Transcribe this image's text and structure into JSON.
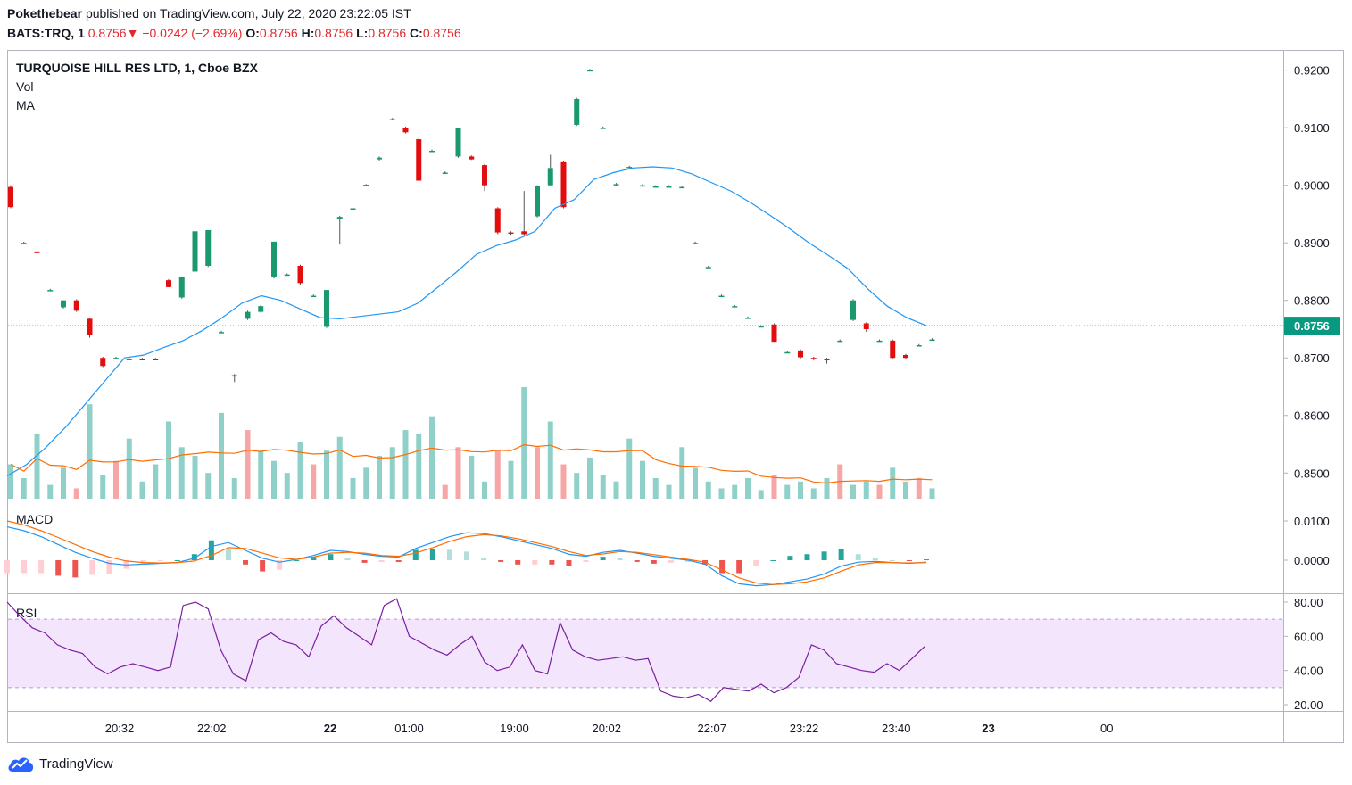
{
  "header": {
    "author": "Pokethebear",
    "published": "published on TradingView.com, July 22, 2020 23:22:05 IST",
    "symbol": "BATS:TRQ, 1",
    "last": "0.8756",
    "change_arrow": "▼",
    "change": "−0.0242 (−2.69%)",
    "o_label": "O:",
    "o": "0.8756",
    "h_label": "H:",
    "h": "0.8756",
    "l_label": "L:",
    "l": "0.8756",
    "c_label": "C:",
    "c": "0.8756"
  },
  "legend": {
    "instrument": "TURQUOISE HILL RES LTD, 1, Cboe BZX",
    "vol": "Vol",
    "ma": "MA",
    "macd": "MACD",
    "rsi": "RSI"
  },
  "brand": "TradingView",
  "colors": {
    "up": "#26a69a",
    "down": "#ef5350",
    "candle_up": "#1a9a6c",
    "candle_down": "#e40d0d",
    "ma": "#2196f3",
    "vol_ma": "#ff6d00",
    "macd": "#2196f3",
    "signal": "#ff6d00",
    "rsi": "#7b1fa2",
    "rsi_band": "#f3e5fb",
    "price_line": "#089981"
  },
  "chart_data": {
    "type": "candlestick",
    "title": "TURQUOISE HILL RES LTD, 1, Cboe BZX",
    "last_price": 0.8756,
    "price_axis": {
      "ticks": [
        "0.9200",
        "0.9100",
        "0.9000",
        "0.8900",
        "0.8800",
        "0.8756",
        "0.8700",
        "0.8600",
        "0.8500"
      ],
      "ylim": [
        0.8457,
        0.9232
      ]
    },
    "macd_axis": {
      "ticks": [
        "0.0100",
        "0.0000"
      ]
    },
    "rsi_axis": {
      "ticks": [
        "80.00",
        "60.00",
        "40.00",
        "20.00"
      ],
      "bands": [
        30,
        70
      ]
    },
    "x_ticks": [
      {
        "label": "20:32",
        "bold": false,
        "i": 8
      },
      {
        "label": "22:02",
        "bold": false,
        "i": 15
      },
      {
        "label": "22",
        "bold": true,
        "i": 24
      },
      {
        "label": "01:00",
        "bold": false,
        "i": 30
      },
      {
        "label": "19:00",
        "bold": false,
        "i": 38
      },
      {
        "label": "20:02",
        "bold": false,
        "i": 45
      },
      {
        "label": "22:07",
        "bold": false,
        "i": 53
      },
      {
        "label": "23:22",
        "bold": false,
        "i": 60
      },
      {
        "label": "23:40",
        "bold": false,
        "i": 67
      },
      {
        "label": "23",
        "bold": true,
        "i": 74
      },
      {
        "label": "00",
        "bold": false,
        "i": 83
      }
    ],
    "candles": [
      {
        "o": 0.8997,
        "h": 0.9,
        "l": 0.896,
        "c": 0.8962
      },
      {
        "o": 0.89,
        "h": 0.8902,
        "l": 0.8898,
        "c": 0.89
      },
      {
        "o": 0.8885,
        "h": 0.8888,
        "l": 0.888,
        "c": 0.8882
      },
      {
        "o": 0.8818,
        "h": 0.882,
        "l": 0.8816,
        "c": 0.8818
      },
      {
        "o": 0.8788,
        "h": 0.88,
        "l": 0.8786,
        "c": 0.88
      },
      {
        "o": 0.88,
        "h": 0.8802,
        "l": 0.878,
        "c": 0.8782
      },
      {
        "o": 0.8768,
        "h": 0.877,
        "l": 0.8735,
        "c": 0.874
      },
      {
        "o": 0.87,
        "h": 0.8702,
        "l": 0.8684,
        "c": 0.8686
      },
      {
        "o": 0.87,
        "h": 0.8702,
        "l": 0.8698,
        "c": 0.87
      },
      {
        "o": 0.8698,
        "h": 0.87,
        "l": 0.8696,
        "c": 0.8698
      },
      {
        "o": 0.8698,
        "h": 0.87,
        "l": 0.8696,
        "c": 0.8697
      },
      {
        "o": 0.8698,
        "h": 0.87,
        "l": 0.8696,
        "c": 0.8697
      },
      {
        "o": 0.8835,
        "h": 0.8837,
        "l": 0.8823,
        "c": 0.8823
      },
      {
        "o": 0.8805,
        "h": 0.884,
        "l": 0.8803,
        "c": 0.884
      },
      {
        "o": 0.885,
        "h": 0.892,
        "l": 0.8848,
        "c": 0.892
      },
      {
        "o": 0.886,
        "h": 0.8922,
        "l": 0.8858,
        "c": 0.8922
      },
      {
        "o": 0.8745,
        "h": 0.8747,
        "l": 0.8743,
        "c": 0.8745
      },
      {
        "o": 0.867,
        "h": 0.8672,
        "l": 0.8658,
        "c": 0.8668
      },
      {
        "o": 0.8768,
        "h": 0.8782,
        "l": 0.8766,
        "c": 0.878
      },
      {
        "o": 0.878,
        "h": 0.8792,
        "l": 0.8778,
        "c": 0.879
      },
      {
        "o": 0.884,
        "h": 0.8902,
        "l": 0.8838,
        "c": 0.8902
      },
      {
        "o": 0.8845,
        "h": 0.8847,
        "l": 0.8843,
        "c": 0.8845
      },
      {
        "o": 0.886,
        "h": 0.8862,
        "l": 0.8826,
        "c": 0.883
      },
      {
        "o": 0.8808,
        "h": 0.881,
        "l": 0.8806,
        "c": 0.8808
      },
      {
        "o": 0.8754,
        "h": 0.8818,
        "l": 0.8752,
        "c": 0.8818
      },
      {
        "o": 0.8942,
        "h": 0.8947,
        "l": 0.8897,
        "c": 0.8945
      },
      {
        "o": 0.896,
        "h": 0.8962,
        "l": 0.8958,
        "c": 0.896
      },
      {
        "o": 0.9,
        "h": 0.9002,
        "l": 0.8998,
        "c": 0.9001
      },
      {
        "o": 0.9045,
        "h": 0.905,
        "l": 0.9043,
        "c": 0.9048
      },
      {
        "o": 0.9115,
        "h": 0.9117,
        "l": 0.9113,
        "c": 0.9115
      },
      {
        "o": 0.91,
        "h": 0.9102,
        "l": 0.909,
        "c": 0.9092
      },
      {
        "o": 0.908,
        "h": 0.9082,
        "l": 0.9008,
        "c": 0.9008
      },
      {
        "o": 0.906,
        "h": 0.9062,
        "l": 0.9058,
        "c": 0.906
      },
      {
        "o": 0.9022,
        "h": 0.9024,
        "l": 0.902,
        "c": 0.9022
      },
      {
        "o": 0.905,
        "h": 0.91,
        "l": 0.9048,
        "c": 0.91
      },
      {
        "o": 0.905,
        "h": 0.9052,
        "l": 0.9044,
        "c": 0.9045
      },
      {
        "o": 0.9035,
        "h": 0.9037,
        "l": 0.899,
        "c": 0.9
      },
      {
        "o": 0.896,
        "h": 0.8962,
        "l": 0.8915,
        "c": 0.8918
      },
      {
        "o": 0.8918,
        "h": 0.892,
        "l": 0.8914,
        "c": 0.8916
      },
      {
        "o": 0.892,
        "h": 0.899,
        "l": 0.8912,
        "c": 0.8915
      },
      {
        "o": 0.8946,
        "h": 0.9,
        "l": 0.8944,
        "c": 0.8998
      },
      {
        "o": 0.9,
        "h": 0.9053,
        "l": 0.8998,
        "c": 0.903
      },
      {
        "o": 0.904,
        "h": 0.9042,
        "l": 0.896,
        "c": 0.8962
      },
      {
        "o": 0.9105,
        "h": 0.9152,
        "l": 0.9103,
        "c": 0.915
      },
      {
        "o": 0.92,
        "h": 0.9202,
        "l": 0.9198,
        "c": 0.92
      },
      {
        "o": 0.91,
        "h": 0.9102,
        "l": 0.9098,
        "c": 0.91
      },
      {
        "o": 0.9002,
        "h": 0.9004,
        "l": 0.9,
        "c": 0.9002
      },
      {
        "o": 0.9032,
        "h": 0.9034,
        "l": 0.903,
        "c": 0.9032
      },
      {
        "o": 0.9,
        "h": 0.9002,
        "l": 0.8998,
        "c": 0.9
      },
      {
        "o": 0.8998,
        "h": 0.9,
        "l": 0.8996,
        "c": 0.8998
      },
      {
        "o": 0.8998,
        "h": 0.9,
        "l": 0.8996,
        "c": 0.8998
      },
      {
        "o": 0.8997,
        "h": 0.8999,
        "l": 0.8995,
        "c": 0.8997
      },
      {
        "o": 0.89,
        "h": 0.8902,
        "l": 0.8898,
        "c": 0.89
      },
      {
        "o": 0.8858,
        "h": 0.886,
        "l": 0.8856,
        "c": 0.8858
      },
      {
        "o": 0.8808,
        "h": 0.881,
        "l": 0.8806,
        "c": 0.8808
      },
      {
        "o": 0.879,
        "h": 0.8792,
        "l": 0.8788,
        "c": 0.879
      },
      {
        "o": 0.877,
        "h": 0.8772,
        "l": 0.8768,
        "c": 0.877
      },
      {
        "o": 0.8755,
        "h": 0.8757,
        "l": 0.8753,
        "c": 0.8755
      },
      {
        "o": 0.8758,
        "h": 0.876,
        "l": 0.8728,
        "c": 0.8728
      },
      {
        "o": 0.871,
        "h": 0.8712,
        "l": 0.8708,
        "c": 0.871
      },
      {
        "o": 0.8713,
        "h": 0.8715,
        "l": 0.8697,
        "c": 0.8701
      },
      {
        "o": 0.87,
        "h": 0.8702,
        "l": 0.8696,
        "c": 0.8698
      },
      {
        "o": 0.8698,
        "h": 0.87,
        "l": 0.869,
        "c": 0.8696
      },
      {
        "o": 0.873,
        "h": 0.8732,
        "l": 0.8728,
        "c": 0.873
      },
      {
        "o": 0.8766,
        "h": 0.8802,
        "l": 0.8764,
        "c": 0.88
      },
      {
        "o": 0.876,
        "h": 0.8762,
        "l": 0.8745,
        "c": 0.875
      },
      {
        "o": 0.873,
        "h": 0.8732,
        "l": 0.8728,
        "c": 0.873
      },
      {
        "o": 0.873,
        "h": 0.8732,
        "l": 0.8699,
        "c": 0.87
      },
      {
        "o": 0.8705,
        "h": 0.8707,
        "l": 0.8697,
        "c": 0.87
      },
      {
        "o": 0.8722,
        "h": 0.8724,
        "l": 0.872,
        "c": 0.8722
      },
      {
        "o": 0.8732,
        "h": 0.8734,
        "l": 0.873,
        "c": 0.8732
      }
    ],
    "ma": [
      0.8495,
      0.8515,
      0.8545,
      0.858,
      0.862,
      0.866,
      0.87,
      0.8705,
      0.8718,
      0.873,
      0.8748,
      0.877,
      0.8795,
      0.8808,
      0.88,
      0.8785,
      0.877,
      0.8768,
      0.8772,
      0.8776,
      0.878,
      0.8795,
      0.8822,
      0.885,
      0.888,
      0.8895,
      0.8905,
      0.892,
      0.896,
      0.8975,
      0.901,
      0.9022,
      0.903,
      0.9032,
      0.903,
      0.902,
      0.9005,
      0.899,
      0.897,
      0.8948,
      0.8925,
      0.89,
      0.8878,
      0.8855,
      0.882,
      0.879,
      0.877,
      0.8756
    ],
    "volume": [
      20,
      12,
      38,
      8,
      18,
      6,
      55,
      14,
      22,
      35,
      10,
      20,
      45,
      30,
      25,
      15,
      50,
      12,
      40,
      28,
      22,
      15,
      33,
      20,
      28,
      36,
      12,
      18,
      25,
      30,
      40,
      38,
      48,
      8,
      30,
      25,
      10,
      28,
      22,
      65,
      30,
      45,
      20,
      15,
      24,
      14,
      10,
      35,
      22,
      12,
      8,
      30,
      18,
      10,
      6,
      8,
      12,
      5,
      14,
      8,
      10,
      6,
      12,
      20,
      8,
      10,
      8,
      18,
      10,
      12,
      6
    ],
    "volume_up": [
      true,
      true,
      true,
      true,
      true,
      false,
      true,
      true,
      false,
      true,
      true,
      true,
      true,
      true,
      true,
      true,
      true,
      true,
      false,
      true,
      true,
      true,
      true,
      false,
      true,
      true,
      true,
      true,
      true,
      true,
      true,
      true,
      true,
      false,
      false,
      true,
      true,
      false,
      true,
      true,
      false,
      true,
      false,
      true,
      true,
      true,
      true,
      true,
      true,
      true,
      true,
      true,
      true,
      true,
      true,
      true,
      true,
      true,
      false,
      true,
      true,
      true,
      true,
      false,
      true,
      true,
      false,
      true,
      true,
      false,
      true
    ],
    "macd": [
      0.0085,
      0.0075,
      0.006,
      0.004,
      0.002,
      0.0005,
      -0.0008,
      -0.0012,
      -0.001,
      -0.0008,
      -0.0006,
      0.0005,
      0.0035,
      0.0045,
      0.0025,
      0.0005,
      -0.0005,
      0.0002,
      0.0012,
      0.0025,
      0.0022,
      0.0015,
      0.001,
      0.0008,
      0.003,
      0.0045,
      0.006,
      0.007,
      0.0068,
      0.006,
      0.005,
      0.004,
      0.003,
      0.0015,
      0.001,
      0.002,
      0.0025,
      0.0018,
      0.001,
      0.0005,
      0.0,
      -0.001,
      -0.004,
      -0.006,
      -0.0065,
      -0.0062,
      -0.0055,
      -0.0048,
      -0.0035,
      -0.0015,
      -0.0005,
      -0.0003,
      -0.0006,
      -0.0008,
      -0.0005
    ],
    "signal": [
      0.01,
      0.009,
      0.0075,
      0.0058,
      0.004,
      0.0022,
      0.0008,
      -0.0002,
      -0.0006,
      -0.0007,
      -0.0006,
      -0.0002,
      0.0012,
      0.0032,
      0.003,
      0.0018,
      0.0006,
      0.0002,
      0.0008,
      0.0018,
      0.002,
      0.0018,
      0.0012,
      0.001,
      0.0018,
      0.0032,
      0.0048,
      0.006,
      0.0065,
      0.0062,
      0.0055,
      0.0045,
      0.0035,
      0.0022,
      0.0012,
      0.0016,
      0.0022,
      0.002,
      0.0014,
      0.0008,
      0.0002,
      -0.0005,
      -0.0025,
      -0.0045,
      -0.0058,
      -0.0062,
      -0.006,
      -0.0055,
      -0.0045,
      -0.0028,
      -0.0012,
      -0.0006,
      -0.0006,
      -0.0007,
      -0.0006
    ],
    "rsi": [
      80,
      72,
      65,
      62,
      55,
      52,
      50,
      42,
      38,
      42,
      44,
      42,
      40,
      42,
      78,
      80,
      76,
      52,
      38,
      34,
      58,
      62,
      57,
      55,
      48,
      66,
      72,
      65,
      60,
      55,
      78,
      82,
      60,
      56,
      52,
      49,
      55,
      60,
      45,
      40,
      42,
      55,
      40,
      38,
      68,
      52,
      48,
      46,
      47,
      48,
      46,
      47,
      28,
      25,
      24,
      26,
      22,
      30,
      29,
      28,
      32,
      27,
      30,
      36,
      55,
      52,
      44,
      42,
      40,
      39,
      44,
      40,
      47,
      54
    ]
  }
}
